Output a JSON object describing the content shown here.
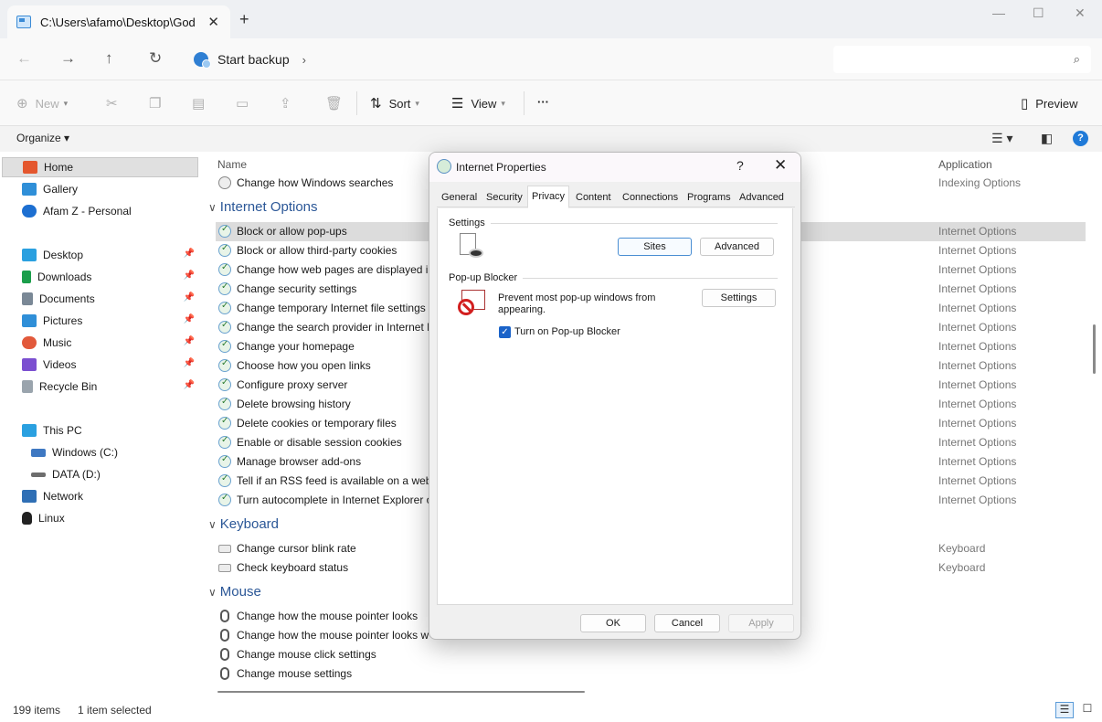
{
  "window": {
    "tab_title": "C:\\Users\\afamo\\Desktop\\God",
    "tab_close": "✕",
    "new_tab": "+",
    "minimize": "—",
    "maximize": "☐",
    "close": "✕"
  },
  "address": {
    "path": "Start backup",
    "back": "←",
    "forward": "→",
    "up": "↑",
    "refresh": "↻",
    "chevron": "›",
    "search_icon": "⌕"
  },
  "commands": {
    "new_label": "New",
    "sort_label": "Sort",
    "view_label": "View",
    "more_label": "···",
    "preview_label": "Preview",
    "organize_label": "Organize ▾"
  },
  "sidebar": {
    "quick": [
      {
        "label": "Home",
        "icon": "home-icon",
        "color": "#e4572e"
      },
      {
        "label": "Gallery",
        "icon": "gallery-icon",
        "color": "#2f8fd8"
      },
      {
        "label": "Afam Z - Personal",
        "icon": "cloud-icon",
        "color": "#1d6fd1"
      }
    ],
    "pinned": [
      {
        "label": "Desktop",
        "icon": "desktop-icon",
        "color": "#2aa0e0"
      },
      {
        "label": "Downloads",
        "icon": "downloads-icon",
        "color": "#1b9e4b"
      },
      {
        "label": "Documents",
        "icon": "documents-icon",
        "color": "#7a8896"
      },
      {
        "label": "Pictures",
        "icon": "pictures-icon",
        "color": "#2f8fd8"
      },
      {
        "label": "Music",
        "icon": "music-icon",
        "color": "#e2593b"
      },
      {
        "label": "Videos",
        "icon": "videos-icon",
        "color": "#7b4fd0"
      },
      {
        "label": "Recycle Bin",
        "icon": "recycle-bin-icon",
        "color": "#9aa4ad"
      }
    ],
    "devices": [
      {
        "label": "This PC",
        "icon": "pc-icon",
        "color": "#2aa0e0"
      },
      {
        "label": "Windows (C:)",
        "icon": "drive-icon",
        "color": "#3e78c2"
      },
      {
        "label": "DATA (D:)",
        "icon": "drive-icon",
        "color": "#6d6d6d"
      },
      {
        "label": "Network",
        "icon": "network-icon",
        "color": "#2f6fb5"
      },
      {
        "label": "Linux",
        "icon": "linux-icon",
        "color": "#222222"
      }
    ]
  },
  "list": {
    "col_name": "Name",
    "col_app": "Application",
    "top_row": {
      "label": "Change how Windows searches",
      "app": "Indexing Options"
    },
    "groups": [
      {
        "title": "Internet Options",
        "rows": [
          {
            "label": "Block or allow pop-ups",
            "app": "Internet Options"
          },
          {
            "label": "Block or allow third-party cookies",
            "app": "Internet Options"
          },
          {
            "label": "Change how web pages are displayed in",
            "app": "Internet Options"
          },
          {
            "label": "Change security settings",
            "app": "Internet Options"
          },
          {
            "label": "Change temporary Internet file settings",
            "app": "Internet Options"
          },
          {
            "label": "Change the search provider in Internet E",
            "app": "Internet Options"
          },
          {
            "label": "Change your homepage",
            "app": "Internet Options"
          },
          {
            "label": "Choose how you open links",
            "app": "Internet Options"
          },
          {
            "label": "Configure proxy server",
            "app": "Internet Options"
          },
          {
            "label": "Delete browsing history",
            "app": "Internet Options"
          },
          {
            "label": "Delete cookies or temporary files",
            "app": "Internet Options"
          },
          {
            "label": "Enable or disable session cookies",
            "app": "Internet Options"
          },
          {
            "label": "Manage browser add-ons",
            "app": "Internet Options"
          },
          {
            "label": "Tell if an RSS feed is available on a websi",
            "app": "Internet Options"
          },
          {
            "label": "Turn autocomplete in Internet Explorer o",
            "app": "Internet Options"
          }
        ]
      },
      {
        "title": "Keyboard",
        "rows": [
          {
            "label": "Change cursor blink rate",
            "app": "Keyboard"
          },
          {
            "label": "Check keyboard status",
            "app": "Keyboard"
          }
        ]
      },
      {
        "title": "Mouse",
        "rows": [
          {
            "label": "Change how the mouse pointer looks",
            "app": ""
          },
          {
            "label": "Change how the mouse pointer looks w",
            "app": ""
          },
          {
            "label": "Change mouse click settings",
            "app": ""
          },
          {
            "label": "Change mouse settings",
            "app": ""
          }
        ]
      }
    ]
  },
  "status": {
    "items": "199 items",
    "selected": "1 item selected"
  },
  "dialog": {
    "title": "Internet Properties",
    "help": "?",
    "close": "✕",
    "tabs": [
      "General",
      "Security",
      "Privacy",
      "Content",
      "Connections",
      "Programs",
      "Advanced"
    ],
    "active_tab": "Privacy",
    "settings_label": "Settings",
    "sites_button": "Sites",
    "advanced_button": "Advanced",
    "popup_label": "Pop-up Blocker",
    "popup_text": "Prevent most pop-up windows from appearing.",
    "popup_settings_button": "Settings",
    "checkbox_label": "Turn on Pop-up Blocker",
    "checkbox_checked": true,
    "ok_button": "OK",
    "cancel_button": "Cancel",
    "apply_button": "Apply"
  }
}
